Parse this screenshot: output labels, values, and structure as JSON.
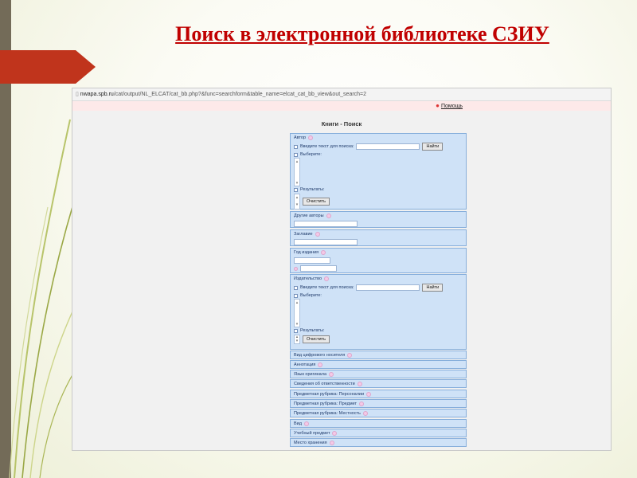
{
  "slide": {
    "title": "Поиск в электронной библиотеке СЗИУ"
  },
  "browser": {
    "url_host": "nwapa.spb.ru",
    "url_path": "/cat/output/NL_ELCAT/cat_bb.php?&func=searchform&table_name=elcat_cat_bb_view&out_search=2"
  },
  "page": {
    "help_link": "Помощь",
    "form_title": "Книги - Поиск"
  },
  "author_panel": {
    "title": "Автор",
    "enter_text_label": "Введите текст для поиска:",
    "find_button": "Найти",
    "choose_label": "Выберите:",
    "results_label": "Результаты:",
    "clear_button": "Очистить"
  },
  "other_authors_panel": {
    "title": "Другие авторы"
  },
  "title_panel": {
    "title": "Заглавие"
  },
  "year_panel": {
    "title": "Год издания"
  },
  "publisher_panel": {
    "title": "Издательство",
    "enter_text_label": "Введите текст для поиска:",
    "find_button": "Найти",
    "choose_label": "Выберите:",
    "results_label": "Результаты:",
    "clear_button": "Очистить"
  },
  "collapsed_panels": [
    "Вид цифрового носителя",
    "Аннотация",
    "Язык оригинала",
    "Сведения об ответственности",
    "Предметная рубрика: Персоналии",
    "Предметная рубрика: Предмет",
    "Предметная рубрика: Местность",
    "Вид",
    "Учебный предмет",
    "Место хранения"
  ]
}
